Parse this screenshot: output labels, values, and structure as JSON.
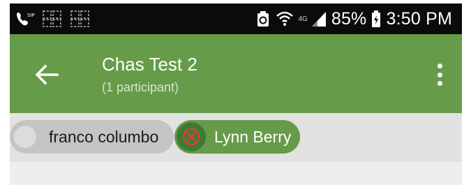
{
  "status_bar": {
    "left_icons": [
      "sip-call-icon",
      "screen-mirror-icon",
      "screen-mirror-icon"
    ],
    "right_icons": [
      "recycle-notification-icon",
      "wifi-calling-icon",
      "signal-icon",
      "battery-icon"
    ],
    "network_label": "4G",
    "battery_percent": "85%",
    "time": "3:50 PM"
  },
  "app_bar": {
    "title": "Chas Test 2",
    "subtitle": "(1 participant)",
    "back_icon": "arrow-left-icon",
    "menu_icon": "more-vertical-icon"
  },
  "participant_chips": [
    {
      "name": "franco columbo",
      "selected": false
    },
    {
      "name": "Lynn Berry",
      "selected": true
    }
  ],
  "colors": {
    "status_bar": "#0b0b0b",
    "app_bar": "#669b49",
    "chip_bar": "#e2e2e2",
    "chip_unselected": "#c4c4c4",
    "chip_selected": "#669b49",
    "remove_icon": "#e23b3b"
  }
}
